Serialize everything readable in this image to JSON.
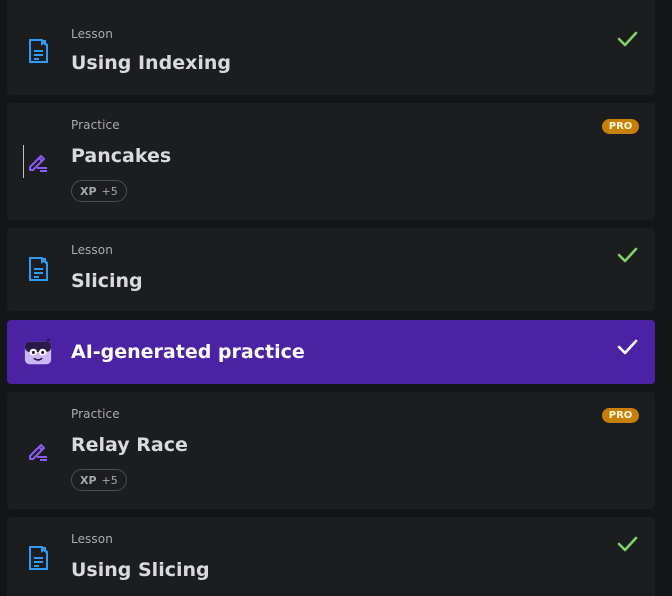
{
  "course_list": {
    "items": [
      {
        "type": "Lesson",
        "title": "Using Indexing",
        "status": "completed",
        "icon": "document-icon"
      },
      {
        "type": "Practice",
        "title": "Pancakes",
        "badge": "PRO",
        "xp_label": "XP",
        "xp_value": "+5",
        "icon": "pencil-icon"
      },
      {
        "type": "Lesson",
        "title": "Slicing",
        "status": "completed",
        "icon": "document-icon"
      },
      {
        "type": "",
        "title": "AI-generated practice",
        "status": "completed",
        "icon": "ai-mascot-icon"
      },
      {
        "type": "Practice",
        "title": "Relay Race",
        "badge": "PRO",
        "xp_label": "XP",
        "xp_value": "+5",
        "icon": "pencil-icon"
      },
      {
        "type": "Lesson",
        "title": "Using Slicing",
        "status": "completed",
        "icon": "document-icon"
      }
    ]
  },
  "colors": {
    "background": "#141517",
    "card": "#1c1d1f",
    "accent_purple": "#4b22a4",
    "check_green": "#7ed36a",
    "pro_orange": "#c77f06",
    "lesson_blue": "#2f9bf5",
    "practice_purple": "#8b5cf6"
  }
}
